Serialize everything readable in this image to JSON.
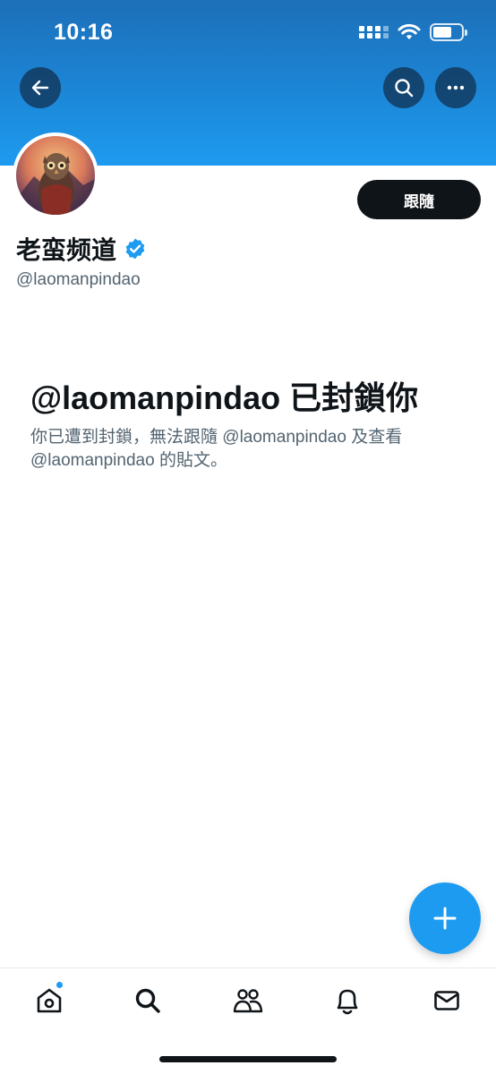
{
  "status_bar": {
    "time": "10:16"
  },
  "header": {
    "back_icon": "arrow-left-icon",
    "search_icon": "search-icon",
    "more_icon": "more-horizontal-icon"
  },
  "profile": {
    "display_name": "老蛮频道",
    "verified_icon": "verified-badge-icon",
    "handle": "@laomanpindao",
    "follow_label": "跟隨"
  },
  "blocked": {
    "title": "@laomanpindao 已封鎖你",
    "description": "你已遭到封鎖，無法跟隨 @laomanpindao 及查看 @laomanpindao 的貼文。"
  },
  "fab": {
    "icon": "plus-icon"
  },
  "tab_bar": {
    "items": [
      "home-icon",
      "search-icon",
      "communities-icon",
      "notifications-icon",
      "messages-icon"
    ],
    "home_has_notification": true
  },
  "colors": {
    "accent": "#1d9bf0",
    "text_primary": "#0f1419",
    "text_secondary": "#536471",
    "banner": "#1d86d6"
  }
}
